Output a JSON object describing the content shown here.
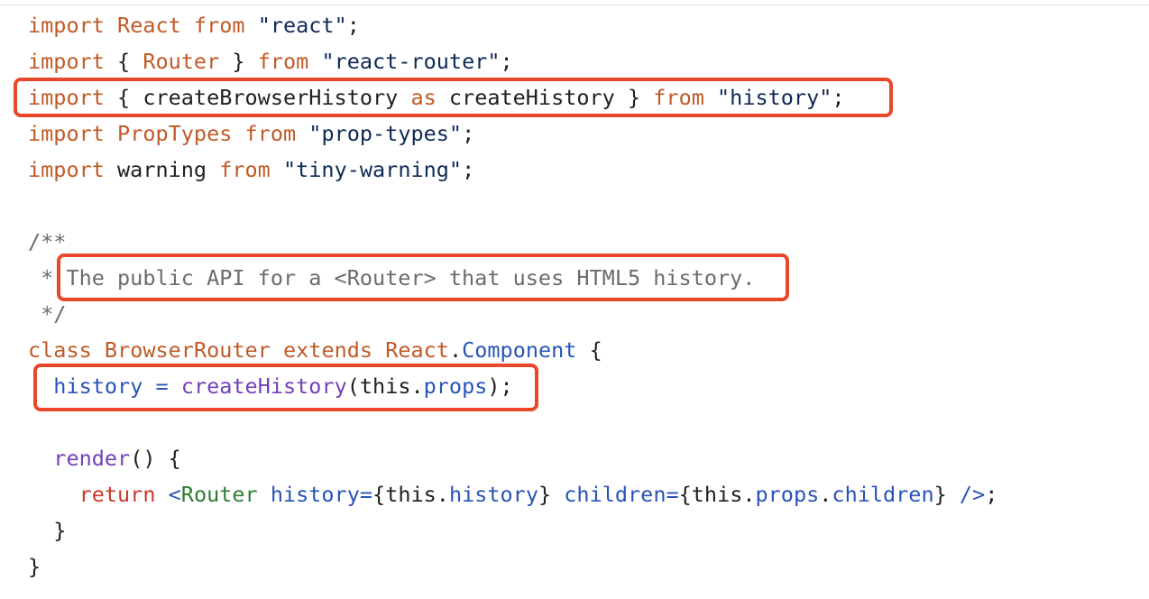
{
  "colors": {
    "keyword": "#c15a26",
    "identifier": "#c15a26",
    "string": "#0d2a55",
    "plain": "#1f1f1f",
    "comment": "#6b6b6b",
    "property": "#2854b7",
    "function": "#7340b8",
    "jsx_tag": "#2e7d32",
    "return": "#c83a2a",
    "highlight_border": "#e8472a"
  },
  "code_lines": [
    [
      {
        "t": "import",
        "c": "keyword"
      },
      {
        "t": " ",
        "c": "plain"
      },
      {
        "t": "React",
        "c": "identifier"
      },
      {
        "t": " ",
        "c": "plain"
      },
      {
        "t": "from",
        "c": "keyword"
      },
      {
        "t": " ",
        "c": "plain"
      },
      {
        "t": "\"react\"",
        "c": "string"
      },
      {
        "t": ";",
        "c": "plain"
      }
    ],
    [
      {
        "t": "import",
        "c": "keyword"
      },
      {
        "t": " { ",
        "c": "plain"
      },
      {
        "t": "Router",
        "c": "identifier"
      },
      {
        "t": " } ",
        "c": "plain"
      },
      {
        "t": "from",
        "c": "keyword"
      },
      {
        "t": " ",
        "c": "plain"
      },
      {
        "t": "\"react-router\"",
        "c": "string"
      },
      {
        "t": ";",
        "c": "plain"
      }
    ],
    [
      {
        "t": "import",
        "c": "keyword"
      },
      {
        "t": " { createBrowserHistory ",
        "c": "plain"
      },
      {
        "t": "as",
        "c": "keyword"
      },
      {
        "t": " createHistory } ",
        "c": "plain"
      },
      {
        "t": "from",
        "c": "keyword"
      },
      {
        "t": " ",
        "c": "plain"
      },
      {
        "t": "\"history\"",
        "c": "string"
      },
      {
        "t": ";",
        "c": "plain"
      }
    ],
    [
      {
        "t": "import",
        "c": "keyword"
      },
      {
        "t": " ",
        "c": "plain"
      },
      {
        "t": "PropTypes",
        "c": "identifier"
      },
      {
        "t": " ",
        "c": "plain"
      },
      {
        "t": "from",
        "c": "keyword"
      },
      {
        "t": " ",
        "c": "plain"
      },
      {
        "t": "\"prop-types\"",
        "c": "string"
      },
      {
        "t": ";",
        "c": "plain"
      }
    ],
    [
      {
        "t": "import",
        "c": "keyword"
      },
      {
        "t": " warning ",
        "c": "plain"
      },
      {
        "t": "from",
        "c": "keyword"
      },
      {
        "t": " ",
        "c": "plain"
      },
      {
        "t": "\"tiny-warning\"",
        "c": "string"
      },
      {
        "t": ";",
        "c": "plain"
      }
    ],
    [],
    [
      {
        "t": "/**",
        "c": "comment"
      }
    ],
    [
      {
        "t": " * The public API for a <Router> that uses HTML5 history.",
        "c": "comment"
      }
    ],
    [
      {
        "t": " */",
        "c": "comment"
      }
    ],
    [
      {
        "t": "class",
        "c": "keyword"
      },
      {
        "t": " ",
        "c": "plain"
      },
      {
        "t": "BrowserRouter",
        "c": "identifier"
      },
      {
        "t": " ",
        "c": "plain"
      },
      {
        "t": "extends",
        "c": "keyword"
      },
      {
        "t": " ",
        "c": "plain"
      },
      {
        "t": "React",
        "c": "identifier"
      },
      {
        "t": ".",
        "c": "plain"
      },
      {
        "t": "Component",
        "c": "property"
      },
      {
        "t": " {",
        "c": "plain"
      }
    ],
    [
      {
        "t": "  ",
        "c": "plain"
      },
      {
        "t": "history",
        "c": "property"
      },
      {
        "t": " ",
        "c": "plain"
      },
      {
        "t": "=",
        "c": "property"
      },
      {
        "t": " ",
        "c": "plain"
      },
      {
        "t": "createHistory",
        "c": "function"
      },
      {
        "t": "(this.",
        "c": "plain"
      },
      {
        "t": "props",
        "c": "property"
      },
      {
        "t": ");",
        "c": "plain"
      }
    ],
    [],
    [
      {
        "t": "  ",
        "c": "plain"
      },
      {
        "t": "render",
        "c": "function"
      },
      {
        "t": "() {",
        "c": "plain"
      }
    ],
    [
      {
        "t": "    ",
        "c": "plain"
      },
      {
        "t": "return",
        "c": "return"
      },
      {
        "t": " ",
        "c": "plain"
      },
      {
        "t": "<",
        "c": "property"
      },
      {
        "t": "Router",
        "c": "jsx_tag"
      },
      {
        "t": " ",
        "c": "plain"
      },
      {
        "t": "history",
        "c": "property"
      },
      {
        "t": "=",
        "c": "property"
      },
      {
        "t": "{this.",
        "c": "plain"
      },
      {
        "t": "history",
        "c": "property"
      },
      {
        "t": "} ",
        "c": "plain"
      },
      {
        "t": "children",
        "c": "property"
      },
      {
        "t": "=",
        "c": "property"
      },
      {
        "t": "{this.",
        "c": "plain"
      },
      {
        "t": "props",
        "c": "property"
      },
      {
        "t": ".",
        "c": "plain"
      },
      {
        "t": "children",
        "c": "property"
      },
      {
        "t": "} ",
        "c": "plain"
      },
      {
        "t": "/>",
        "c": "property"
      },
      {
        "t": ";",
        "c": "plain"
      }
    ],
    [
      {
        "t": "  }",
        "c": "plain"
      }
    ],
    [
      {
        "t": "}",
        "c": "plain"
      }
    ]
  ]
}
